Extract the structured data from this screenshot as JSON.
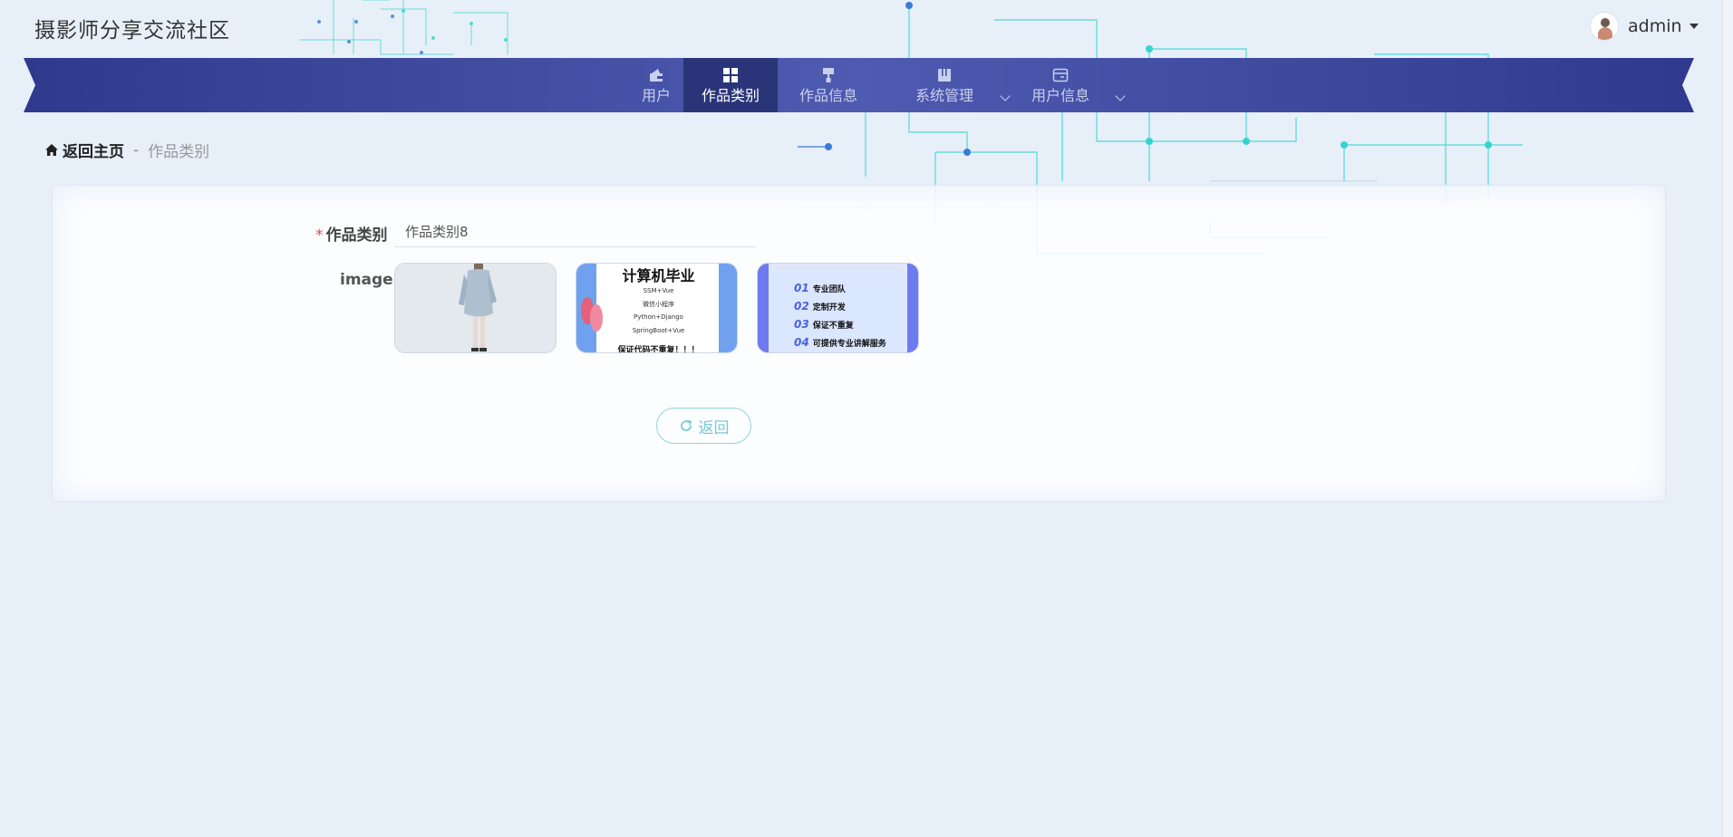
{
  "header": {
    "site_title": "摄影师分享交流社区",
    "user_name": "admin"
  },
  "nav": {
    "items": [
      {
        "label": "用户",
        "icon": "wallet-icon",
        "active": false
      },
      {
        "label": "作品类别",
        "icon": "grid-icon",
        "active": true
      },
      {
        "label": "作品信息",
        "icon": "paint-roller-icon",
        "active": false
      },
      {
        "label": "系统管理",
        "icon": "book-icon",
        "active": false,
        "dropdown": true
      },
      {
        "label": "用户信息",
        "icon": "window-icon",
        "active": false,
        "dropdown": true
      }
    ]
  },
  "breadcrumb": {
    "home": "返回主页",
    "separator": "-",
    "current": "作品类别"
  },
  "form": {
    "category_label": "作品类别",
    "required_mark": "*",
    "category_value": "作品类别8",
    "image_label": "image",
    "images": [
      {
        "alt": "photo-person-icon"
      },
      {
        "alt": "poster-computer-graduation",
        "title": "计算机毕业",
        "lines": [
          "SSM+Vue",
          "微信小程序",
          "Python+Django",
          "SpringBoot+Vue"
        ],
        "footer": "保证代码不重复！！！"
      },
      {
        "alt": "poster-features",
        "items": [
          {
            "num": "01",
            "text": "专业团队"
          },
          {
            "num": "02",
            "text": "定制开发"
          },
          {
            "num": "03",
            "text": "保证不重复"
          },
          {
            "num": "04",
            "text": "可提供专业讲解服务"
          }
        ]
      }
    ],
    "back_button": "返回"
  },
  "colors": {
    "nav_bg": "#3f4da0",
    "nav_active": "#2a3478",
    "page_bg": "#e7eff9",
    "circuit": "#35d5cf",
    "button": "#79c9d8"
  }
}
